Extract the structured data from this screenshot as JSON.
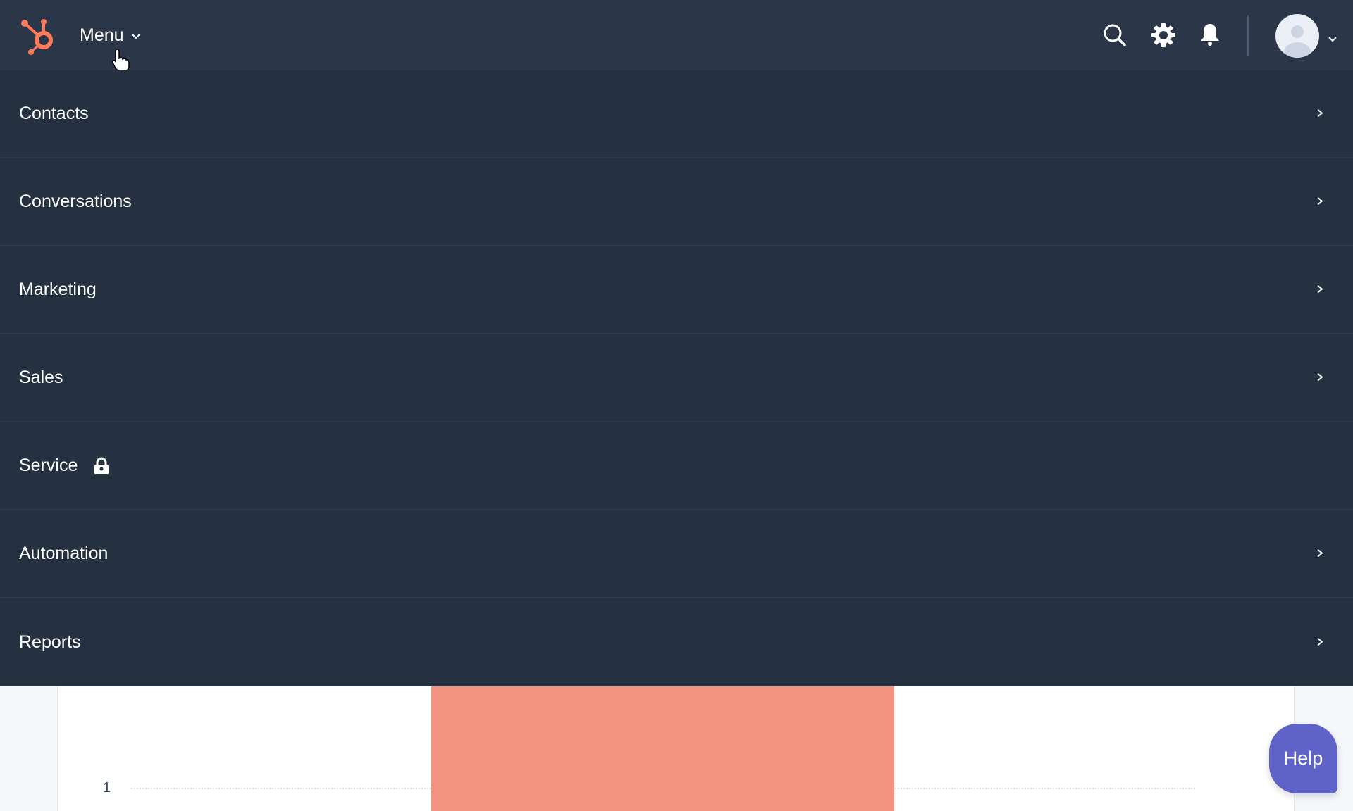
{
  "header": {
    "menu_label": "Menu",
    "brand_color": "#ff7a59"
  },
  "nav": {
    "items": [
      {
        "label": "Contacts",
        "locked": false
      },
      {
        "label": "Conversations",
        "locked": false
      },
      {
        "label": "Marketing",
        "locked": false
      },
      {
        "label": "Sales",
        "locked": false
      },
      {
        "label": "Service",
        "locked": true
      },
      {
        "label": "Automation",
        "locked": false
      },
      {
        "label": "Reports",
        "locked": false
      }
    ]
  },
  "chart": {
    "y_tick": "1",
    "bar_color": "#f2937f"
  },
  "help": {
    "label": "Help",
    "color": "#5f62c6"
  }
}
